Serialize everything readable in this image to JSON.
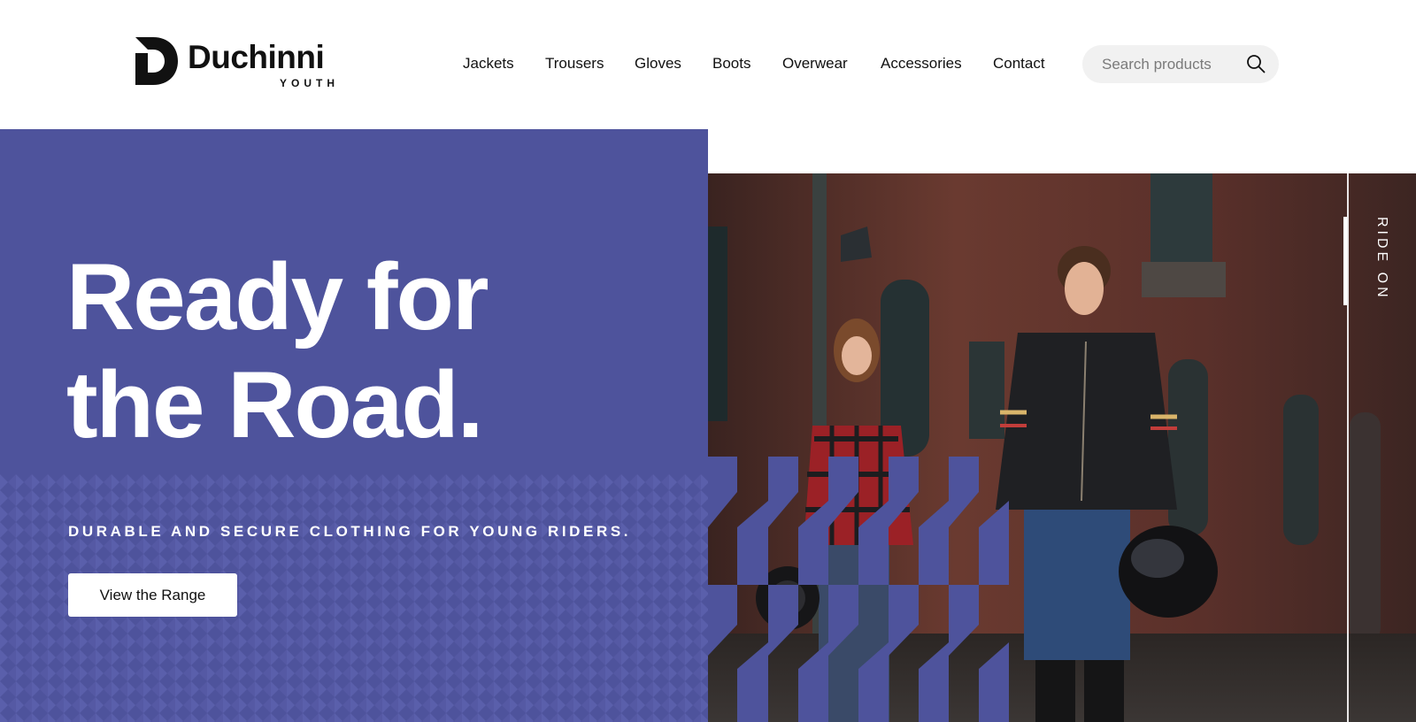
{
  "brand": {
    "name": "Duchinni",
    "sub": "YOUTH"
  },
  "nav": {
    "items": [
      "Jackets",
      "Trousers",
      "Gloves",
      "Boots",
      "Overwear",
      "Accessories",
      "Contact"
    ]
  },
  "search": {
    "placeholder": "Search products"
  },
  "hero": {
    "headline_line1": "Ready for",
    "headline_line2": "the Road.",
    "tagline": "DURABLE AND SECURE CLOTHING FOR YOUNG RIDERS.",
    "cta_label": "View the Range",
    "side_label": "RIDE ON"
  },
  "colors": {
    "brand_purple": "#4e539c",
    "pattern_purple": "#5a5fab",
    "text_dark": "#111111",
    "search_bg": "#f1f1f1"
  },
  "icons": {
    "search": "search-icon",
    "logo": "duchinni-d-logo-icon"
  }
}
